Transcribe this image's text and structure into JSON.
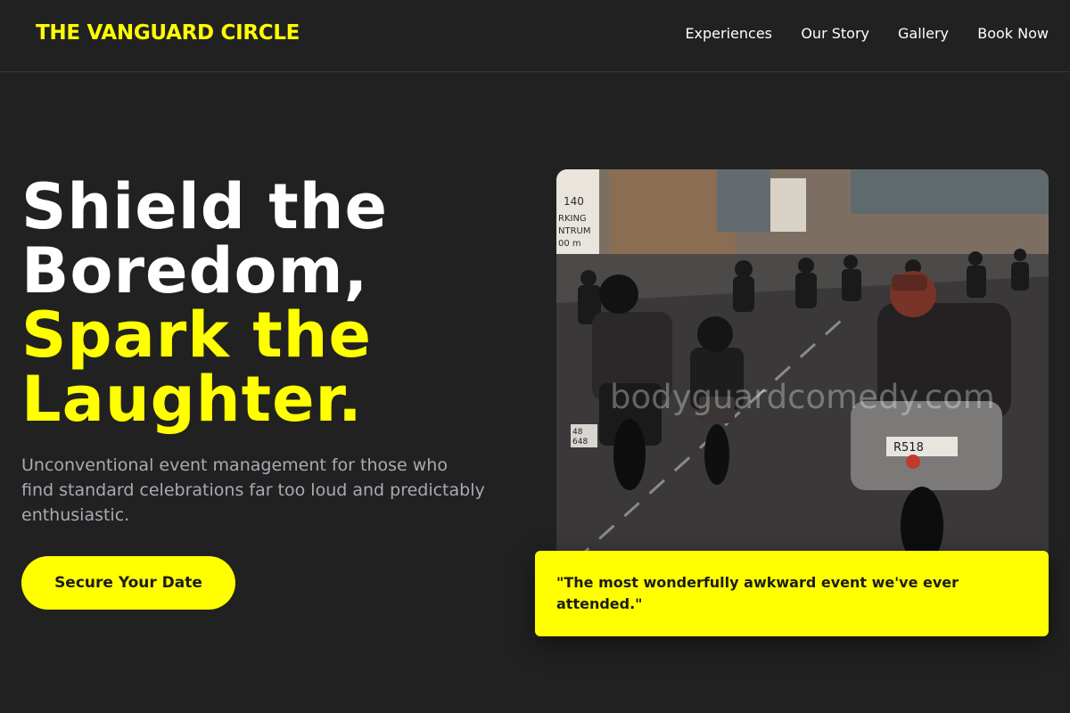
{
  "brand": {
    "name": "THE VANGUARD CIRCLE"
  },
  "nav": {
    "links": [
      "Experiences",
      "Our Story",
      "Gallery",
      "Book Now"
    ]
  },
  "hero": {
    "title_line1": "Shield the",
    "title_line2": "Boredom,",
    "title_line3": "Spark the",
    "title_line4": "Laughter.",
    "subtitle": "Unconventional event management for those who find standard celebrations far too loud and predictably enthusiastic.",
    "cta_label": "Secure Your Date"
  },
  "photo": {
    "subject": "motorcycle-convoy-photo",
    "watermark": "bodyguardcomedy.com",
    "plates": [
      "140",
      "RKING",
      "NTRUM",
      "00 m",
      "48",
      "648",
      "R518"
    ]
  },
  "testimonial": {
    "quote": "\"The most wonderfully awkward event we've ever attended.\""
  },
  "colors": {
    "background": "#212121",
    "accent": "#ffff00",
    "text": "#ffffff",
    "muted": "#a7abb4"
  }
}
